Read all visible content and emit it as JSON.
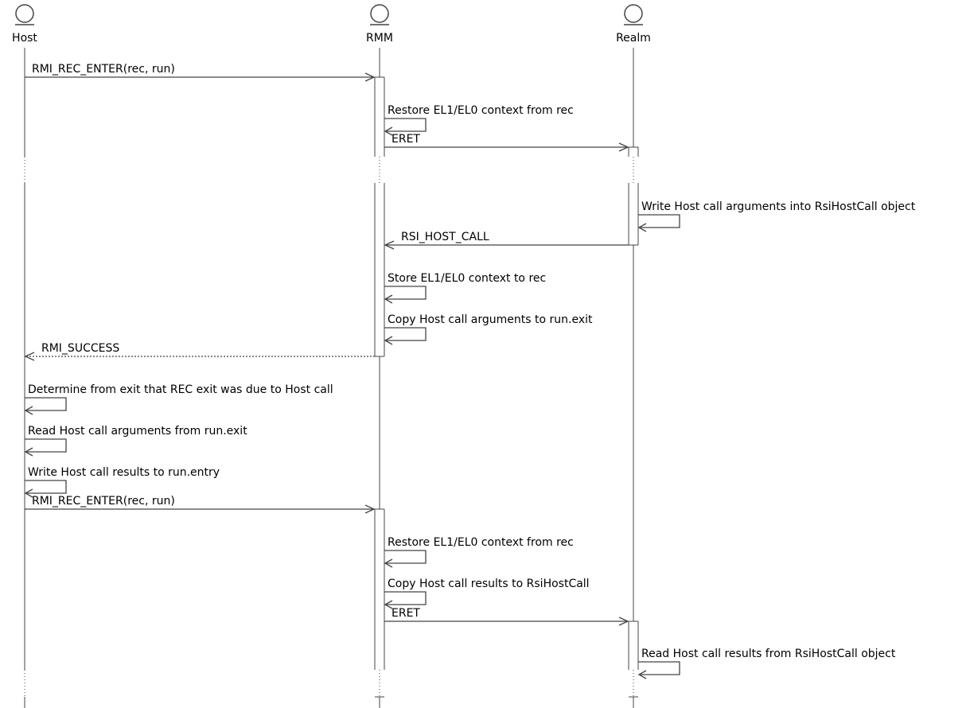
{
  "participants": [
    {
      "id": "host",
      "name": "Host",
      "icon": "entity-circle-icon"
    },
    {
      "id": "rmm",
      "name": "RMM",
      "icon": "entity-circle-icon"
    },
    {
      "id": "realm",
      "name": "Realm",
      "icon": "entity-circle-icon"
    }
  ],
  "messages": [
    {
      "from": "host",
      "to": "rmm",
      "label": "RMI_REC_ENTER(rec, run)",
      "style": "solid"
    },
    {
      "from": "rmm",
      "to": "rmm",
      "label": "Restore EL1/EL0 context from rec",
      "style": "self"
    },
    {
      "from": "rmm",
      "to": "realm",
      "label": "ERET",
      "style": "solid"
    },
    {
      "from": "realm",
      "to": "realm",
      "label": "Write Host call arguments into RsiHostCall object",
      "style": "self"
    },
    {
      "from": "realm",
      "to": "rmm",
      "label": "RSI_HOST_CALL",
      "style": "solid"
    },
    {
      "from": "rmm",
      "to": "rmm",
      "label": "Store EL1/EL0 context to rec",
      "style": "self"
    },
    {
      "from": "rmm",
      "to": "rmm",
      "label": "Copy Host call arguments to run.exit",
      "style": "self"
    },
    {
      "from": "rmm",
      "to": "host",
      "label": "RMI_SUCCESS",
      "style": "dashed"
    },
    {
      "from": "host",
      "to": "host",
      "label": "Determine from exit that REC exit was due to Host call",
      "style": "self"
    },
    {
      "from": "host",
      "to": "host",
      "label": "Read Host call arguments from run.exit",
      "style": "self"
    },
    {
      "from": "host",
      "to": "host",
      "label": "Write Host call results to run.entry",
      "style": "self"
    },
    {
      "from": "host",
      "to": "rmm",
      "label": "RMI_REC_ENTER(rec, run)",
      "style": "solid"
    },
    {
      "from": "rmm",
      "to": "rmm",
      "label": "Restore EL1/EL0 context from rec",
      "style": "self"
    },
    {
      "from": "rmm",
      "to": "rmm",
      "label": "Copy Host call results to RsiHostCall",
      "style": "self"
    },
    {
      "from": "rmm",
      "to": "realm",
      "label": "ERET",
      "style": "solid"
    },
    {
      "from": "realm",
      "to": "realm",
      "label": "Read Host call results from RsiHostCall object",
      "style": "self"
    }
  ],
  "colors": {
    "line": "#444444",
    "text": "#000000",
    "background": "#ffffff"
  }
}
